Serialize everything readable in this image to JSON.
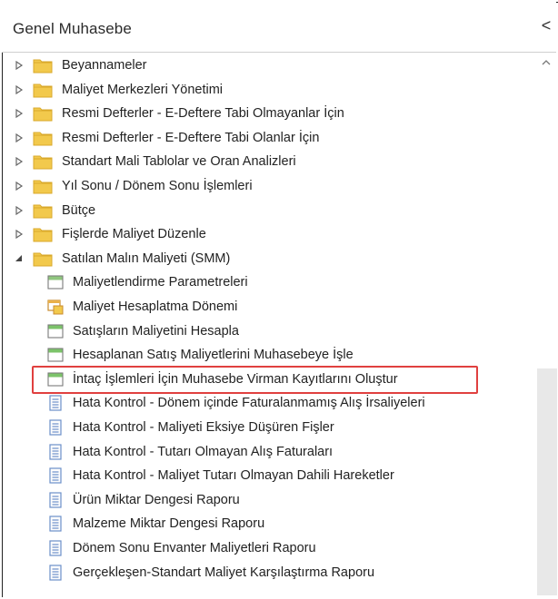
{
  "panel": {
    "title": "Genel Muhasebe",
    "collapse_glyph": "<"
  },
  "tree": {
    "folders": [
      {
        "label": "Beyannameler",
        "expanded": false
      },
      {
        "label": "Maliyet Merkezleri Yönetimi",
        "expanded": false
      },
      {
        "label": "Resmi Defterler - E-Deftere Tabi Olmayanlar İçin",
        "expanded": false
      },
      {
        "label": "Resmi Defterler - E-Deftere Tabi Olanlar İçin",
        "expanded": false
      },
      {
        "label": "Standart Mali Tablolar ve Oran Analizleri",
        "expanded": false
      },
      {
        "label": "Yıl Sonu / Dönem Sonu İşlemleri",
        "expanded": false
      },
      {
        "label": "Bütçe",
        "expanded": false
      },
      {
        "label": "Fişlerde Maliyet Düzenle",
        "expanded": false
      },
      {
        "label": "Satılan Malın Maliyeti (SMM)",
        "expanded": true
      }
    ],
    "children": [
      {
        "label": "Maliyetlendirme Parametreleri",
        "icon": "form-window-icon"
      },
      {
        "label": "Maliyet Hesaplatma Dönemi",
        "icon": "period-window-icon"
      },
      {
        "label": "Satışların Maliyetini Hesapla",
        "icon": "form-window-green-icon"
      },
      {
        "label": "Hesaplanan Satış Maliyetlerini Muhasebeye İşle",
        "icon": "form-window-green-icon"
      },
      {
        "label": "İntaç İşlemleri İçin Muhasebe Virman Kayıtlarını Oluştur",
        "icon": "form-window-green-icon",
        "highlighted": true
      },
      {
        "label": "Hata Kontrol - Dönem içinde Faturalanmamış Alış İrsaliyeleri",
        "icon": "report-icon"
      },
      {
        "label": "Hata Kontrol - Maliyeti Eksiye Düşüren Fişler",
        "icon": "report-icon"
      },
      {
        "label": "Hata Kontrol - Tutarı Olmayan Alış Faturaları",
        "icon": "report-icon"
      },
      {
        "label": "Hata Kontrol - Maliyet Tutarı Olmayan Dahili Hareketler",
        "icon": "report-icon"
      },
      {
        "label": "Ürün Miktar Dengesi Raporu",
        "icon": "report-icon"
      },
      {
        "label": "Malzeme Miktar Dengesi Raporu",
        "icon": "report-icon"
      },
      {
        "label": "Dönem Sonu Envanter Maliyetleri Raporu",
        "icon": "report-icon"
      },
      {
        "label": "Gerçekleşen-Standart Maliyet Karşılaştırma Raporu",
        "icon": "report-icon"
      }
    ]
  },
  "colors": {
    "folder": "#f2c94c",
    "folder_dark": "#d9a92b",
    "highlight": "#e0403f",
    "green": "#7cc36a"
  }
}
